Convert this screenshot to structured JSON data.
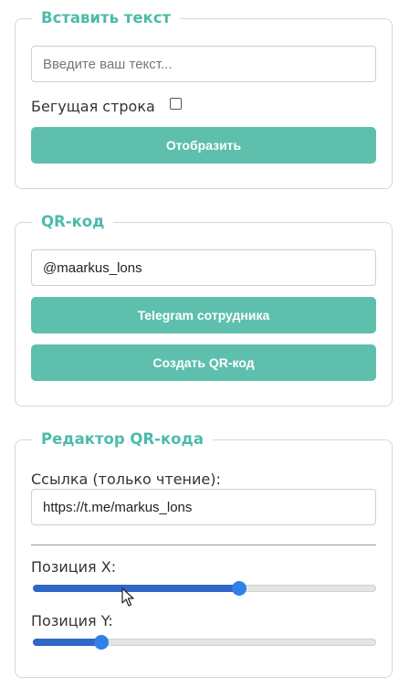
{
  "text_panel": {
    "legend": "Вставить текст",
    "input_placeholder": "Введите ваш текст...",
    "marquee_label": "Бегущая строка",
    "marquee_checked": false,
    "display_button": "Отобразить"
  },
  "qr_panel": {
    "legend": "QR-код",
    "input_value": "@maarkus_lons",
    "telegram_button": "Telegram сотрудника",
    "create_button": "Создать QR-код"
  },
  "editor_panel": {
    "legend": "Редактор QR-кода",
    "link_label": "Ссылка (только чтение):",
    "link_value": "https://t.me/markus_lons",
    "position_x_label": "Позиция X:",
    "position_x_value": 0.6,
    "position_y_label": "Позиция Y:",
    "position_y_value": 0.2
  },
  "colors": {
    "accent": "#5ebfad",
    "legend": "#4dbbaa",
    "slider_fill": "#2f66c8",
    "slider_thumb": "#2f80e8"
  },
  "icons": {
    "cursor": "arrow-cursor-icon"
  }
}
